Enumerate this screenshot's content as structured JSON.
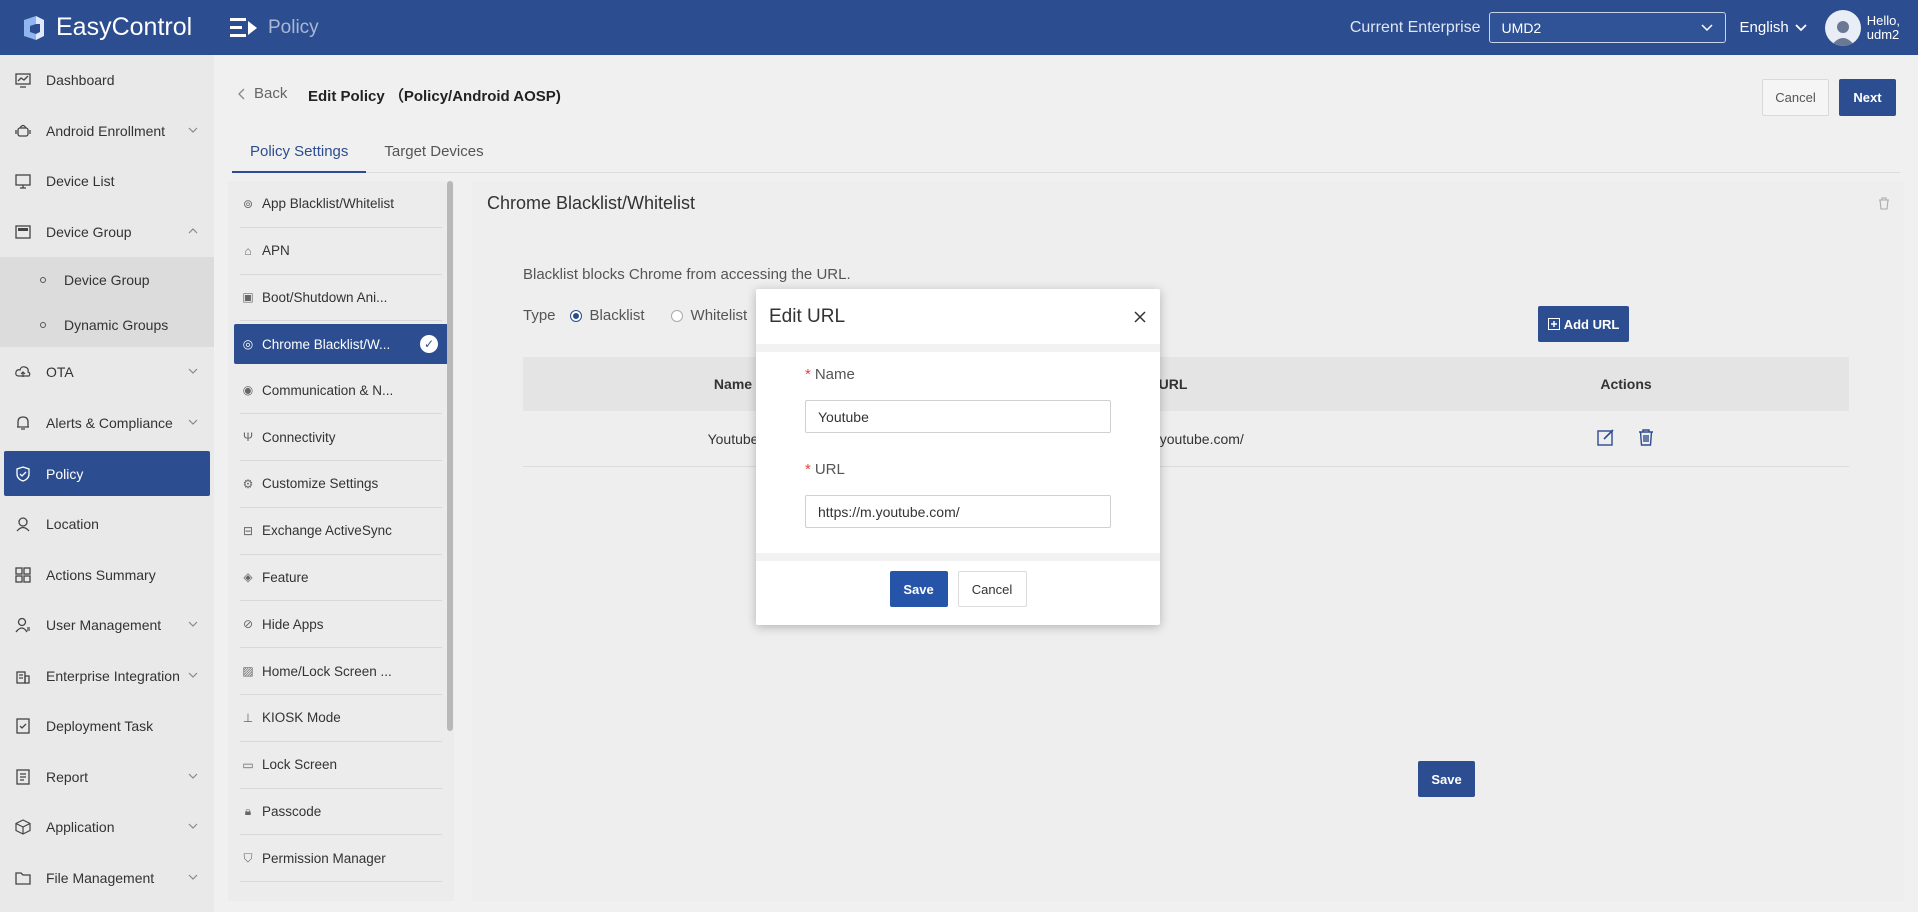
{
  "app": {
    "name": "EasyControl",
    "page": "Policy"
  },
  "topbar": {
    "enterprise_label": "Current Enterprise",
    "enterprise_value": "UMD2",
    "language": "English",
    "greeting_line1": "Hello,",
    "greeting_line2": "udm2"
  },
  "sidebar": {
    "items": [
      {
        "label": "Dashboard",
        "icon": "dashboard-icon"
      },
      {
        "label": "Android Enrollment",
        "icon": "android-icon"
      },
      {
        "label": "Device List",
        "icon": "monitor-icon"
      },
      {
        "label": "Device Group",
        "icon": "group-icon"
      },
      {
        "label": "OTA",
        "icon": "cloud-upload-icon"
      },
      {
        "label": "Alerts & Compliance",
        "icon": "bell-icon"
      },
      {
        "label": "Policy",
        "icon": "shield-icon"
      },
      {
        "label": "Location",
        "icon": "location-icon"
      },
      {
        "label": "Actions Summary",
        "icon": "grid-icon"
      },
      {
        "label": "User Management",
        "icon": "user-icon"
      },
      {
        "label": "Enterprise Integration",
        "icon": "building-icon"
      },
      {
        "label": "Deployment Task",
        "icon": "task-icon"
      },
      {
        "label": "Report",
        "icon": "report-icon"
      },
      {
        "label": "Application",
        "icon": "cube-icon"
      },
      {
        "label": "File Management",
        "icon": "folder-icon"
      }
    ],
    "sub_items": [
      {
        "label": "Device Group"
      },
      {
        "label": "Dynamic Groups"
      }
    ]
  },
  "header": {
    "back": "Back",
    "title": "Edit Policy （Policy/Android AOSP)",
    "cancel": "Cancel",
    "next": "Next"
  },
  "tabs": [
    {
      "label": "Policy Settings"
    },
    {
      "label": "Target Devices"
    }
  ],
  "policy_list": [
    {
      "label": "App Blacklist/Whitelist"
    },
    {
      "label": "APN"
    },
    {
      "label": "Boot/Shutdown Ani..."
    },
    {
      "label": "Chrome Blacklist/W..."
    },
    {
      "label": "Communication & N..."
    },
    {
      "label": "Connectivity"
    },
    {
      "label": "Customize Settings"
    },
    {
      "label": "Exchange ActiveSync"
    },
    {
      "label": "Feature"
    },
    {
      "label": "Hide Apps"
    },
    {
      "label": "Home/Lock Screen ..."
    },
    {
      "label": "KIOSK Mode"
    },
    {
      "label": "Lock Screen"
    },
    {
      "label": "Passcode"
    },
    {
      "label": "Permission Manager"
    }
  ],
  "content": {
    "title": "Chrome Blacklist/Whitelist",
    "hint": "Blacklist blocks Chrome from accessing the URL.",
    "type_label": "Type",
    "type_options": [
      "Blacklist",
      "Whitelist"
    ],
    "type_selected": "Blacklist",
    "add_url": "Add URL",
    "columns": [
      "Name",
      "URL",
      "Actions"
    ],
    "rows": [
      {
        "name": "Youtube",
        "url": "https://m.youtube.com/"
      }
    ],
    "save": "Save"
  },
  "modal": {
    "title": "Edit URL",
    "name_label": "Name",
    "name_value": "Youtube",
    "url_label": "URL",
    "url_value": "https://m.youtube.com/",
    "save": "Save",
    "cancel": "Cancel"
  },
  "colors": {
    "brand": "#2c4d8f",
    "required": "#e6443a"
  }
}
